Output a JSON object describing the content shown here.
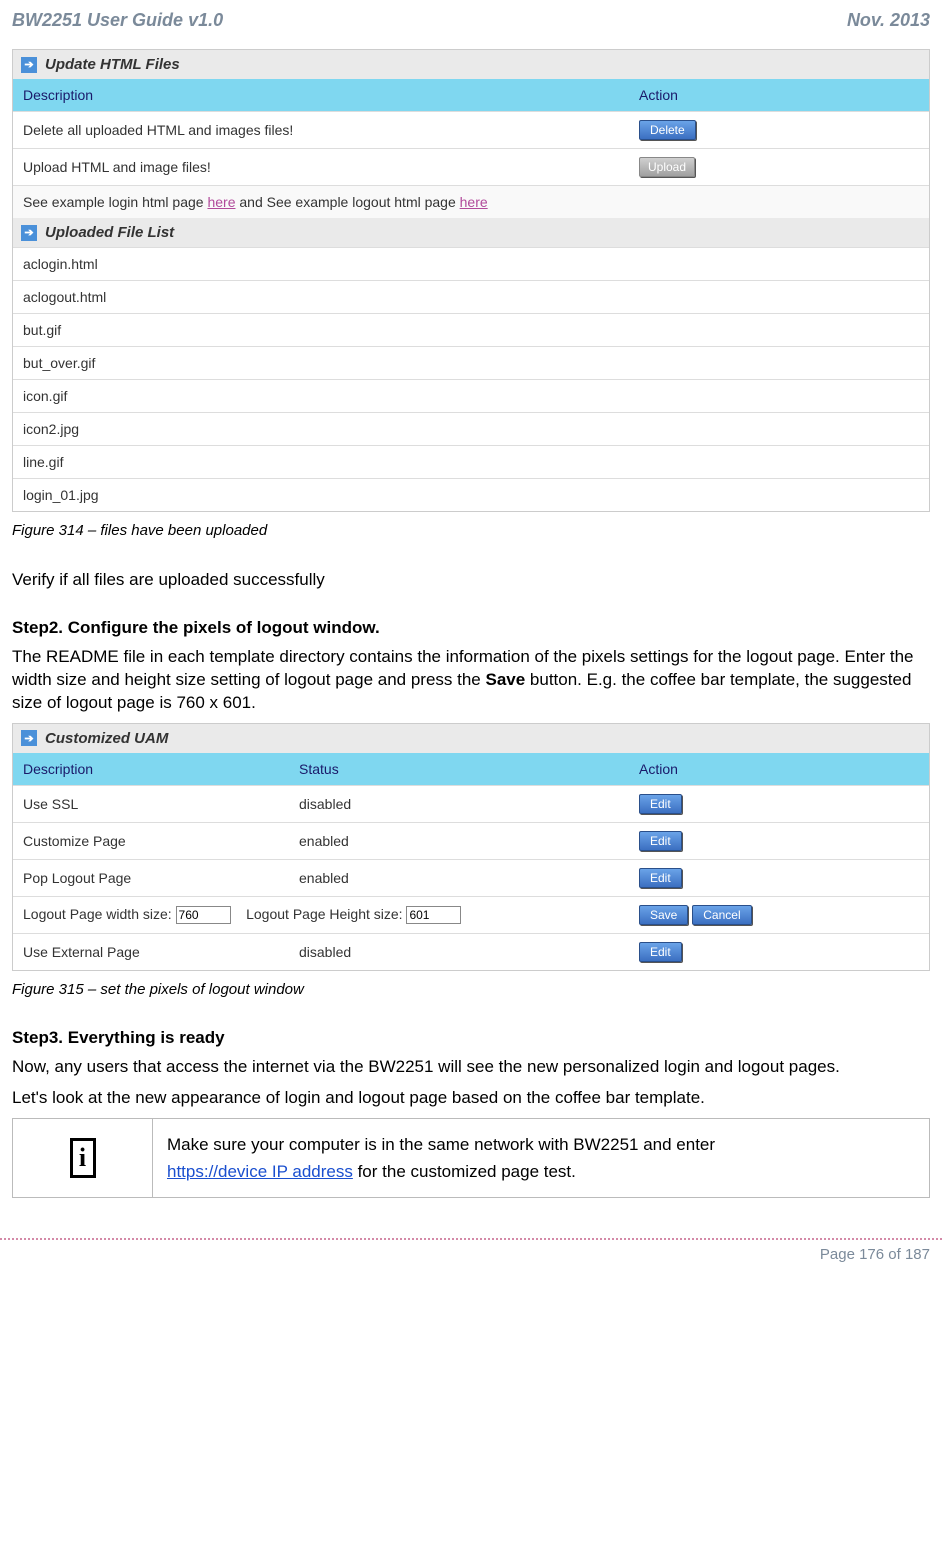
{
  "header": {
    "left": "BW2251 User Guide v1.0",
    "right": "Nov.  2013"
  },
  "panel1": {
    "title": "Update HTML Files",
    "cols": {
      "desc": "Description",
      "action": "Action"
    },
    "rows": [
      {
        "desc": "Delete all uploaded HTML and images files!",
        "button": "Delete",
        "btnType": "btn"
      },
      {
        "desc": "Upload HTML and image files!",
        "button": "Upload",
        "btnType": "btn-gray"
      }
    ],
    "see": {
      "prefix": "See example login html page ",
      "link1": "here",
      "mid": " and See example logout html page ",
      "link2": "here"
    }
  },
  "panel2": {
    "title": "Uploaded File List",
    "files": [
      "aclogin.html",
      "aclogout.html",
      "but.gif",
      "but_over.gif",
      "icon.gif",
      "icon2.jpg",
      "line.gif",
      "login_01.jpg"
    ]
  },
  "caption1": "Figure 314  – files have been uploaded",
  "verify": "Verify if all files are uploaded successfully",
  "step2": {
    "title": "Step2. Configure the pixels of logout window.",
    "para_a": "The README file in each template directory contains the information of the pixels settings for the logout page. Enter the width size and height size setting of logout page and press the ",
    "save_word": "Save",
    "para_b": " button. E.g. the coffee bar template, the suggested size of logout page is 760 x 601."
  },
  "panel3": {
    "title": "Customized UAM",
    "cols": {
      "desc": "Description",
      "status": "Status",
      "action": "Action"
    },
    "rows": [
      {
        "desc": "Use SSL",
        "status": "disabled",
        "buttons": [
          "Edit"
        ]
      },
      {
        "desc": "Customize Page",
        "status": "enabled",
        "buttons": [
          "Edit"
        ]
      },
      {
        "desc": "Pop Logout Page",
        "status": "enabled",
        "buttons": [
          "Edit"
        ]
      }
    ],
    "logoutRow": {
      "widthLabel": "Logout Page width size:",
      "widthVal": "760",
      "heightLabel": "Logout Page Height size:",
      "heightVal": "601",
      "buttons": [
        "Save",
        "Cancel"
      ]
    },
    "extRow": {
      "desc": "Use External Page",
      "status": "disabled",
      "buttons": [
        "Edit"
      ]
    }
  },
  "caption2": "Figure 315  – set the pixels of logout window",
  "step3": {
    "title": "Step3. Everything is ready",
    "para1": "Now, any users that access the internet via the BW2251 will see the new personalized login and logout pages.",
    "para2": "Let's look at the new appearance of login and logout page based on the coffee bar template."
  },
  "note": {
    "line1": "Make sure your computer is in the same network with BW2251 and enter",
    "link": "https://device IP address",
    "line2": " for the customized page test."
  },
  "footer": "Page 176 of 187"
}
